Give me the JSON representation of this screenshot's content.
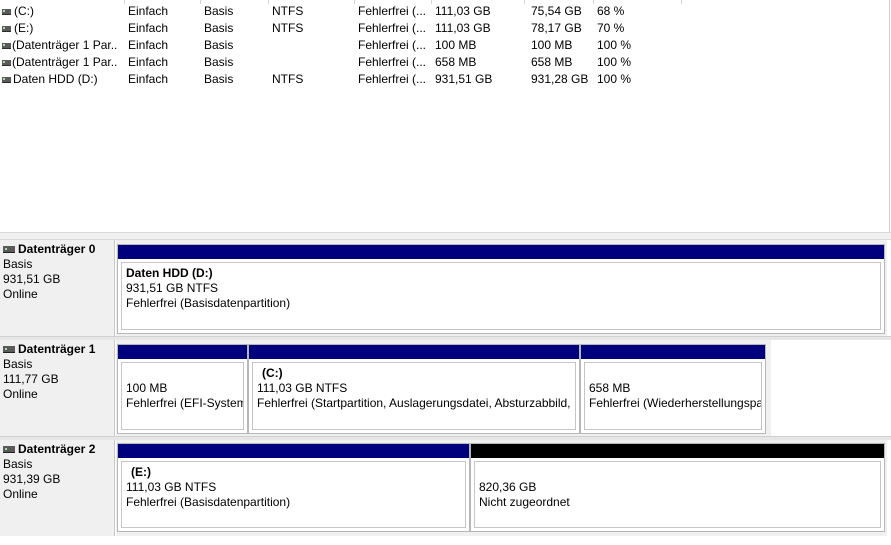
{
  "volumes": [
    {
      "name": "(C:)",
      "layout": "Einfach",
      "type": "Basis",
      "fs": "NTFS",
      "status": "Fehlerfrei (...",
      "capacity": "111,03 GB",
      "free": "75,54 GB",
      "pct": "68 %"
    },
    {
      "name": "(E:)",
      "layout": "Einfach",
      "type": "Basis",
      "fs": "NTFS",
      "status": "Fehlerfrei (...",
      "capacity": "111,03 GB",
      "free": "78,17 GB",
      "pct": "70 %"
    },
    {
      "name": "(Datenträger 1 Par...",
      "layout": "Einfach",
      "type": "Basis",
      "fs": "",
      "status": "Fehlerfrei (...",
      "capacity": "100 MB",
      "free": "100 MB",
      "pct": "100 %"
    },
    {
      "name": "(Datenträger 1 Par...",
      "layout": "Einfach",
      "type": "Basis",
      "fs": "",
      "status": "Fehlerfrei (...",
      "capacity": "658 MB",
      "free": "658 MB",
      "pct": "100 %"
    },
    {
      "name": "Daten HDD (D:)",
      "layout": "Einfach",
      "type": "Basis",
      "fs": "NTFS",
      "status": "Fehlerfrei (...",
      "capacity": "931,51 GB",
      "free": "931,28 GB",
      "pct": "100 %"
    }
  ],
  "disks": [
    {
      "title": "Datenträger 0",
      "type": "Basis",
      "size": "931,51 GB",
      "state": "Online",
      "partitions": [
        {
          "title": "Daten HDD  (D:)",
          "size": "931,51 GB NTFS",
          "status": "Fehlerfrei (Basisdatenpartition)",
          "bar": "blue"
        }
      ]
    },
    {
      "title": "Datenträger 1",
      "type": "Basis",
      "size": "111,77 GB",
      "state": "Online",
      "partitions": [
        {
          "title": "",
          "size": "100 MB",
          "status": "Fehlerfrei (EFI-System",
          "bar": "blue"
        },
        {
          "title": "(C:)",
          "size": "111,03 GB NTFS",
          "status": "Fehlerfrei (Startpartition, Auslagerungsdatei, Absturzabbild, I",
          "bar": "blue"
        },
        {
          "title": "",
          "size": "658 MB",
          "status": "Fehlerfrei (Wiederherstellungspa",
          "bar": "blue"
        }
      ]
    },
    {
      "title": "Datenträger 2",
      "type": "Basis",
      "size": "931,39 GB",
      "state": "Online",
      "partitions": [
        {
          "title": "(E:)",
          "size": "111,03 GB NTFS",
          "status": "Fehlerfrei (Basisdatenpartition)",
          "bar": "blue"
        },
        {
          "title": "",
          "size": "820,36 GB",
          "status": "Nicht zugeordnet",
          "bar": "black"
        }
      ]
    }
  ],
  "colors": {
    "partition_bar": "#00007f",
    "unallocated_bar": "#000000",
    "panel_bg": "#f0f0f0"
  }
}
